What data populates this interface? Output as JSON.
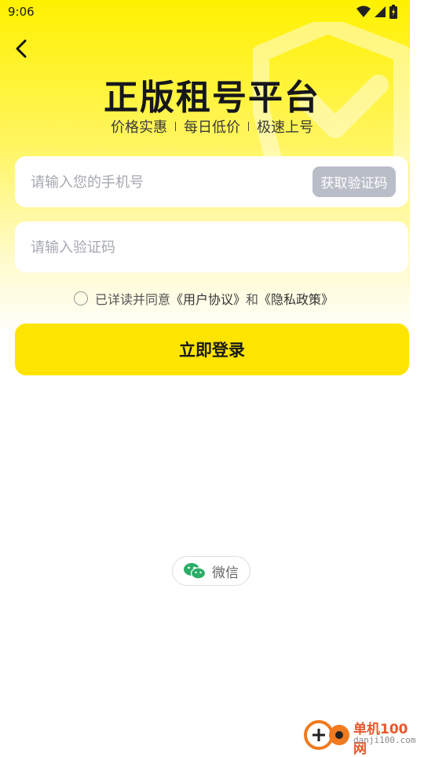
{
  "status_bar": {
    "time": "9:06"
  },
  "header": {
    "title": "正版租号平台",
    "subtitle_items": [
      "价格实惠",
      "每日低价",
      "极速上号"
    ]
  },
  "form": {
    "phone_placeholder": "请输入您的手机号",
    "get_code_label": "获取验证码",
    "code_placeholder": "请输入验证码"
  },
  "agreement": {
    "prefix": "已详读并同意",
    "user_agreement": "《用户协议》",
    "conjunction": "和",
    "privacy_policy": "《隐私政策》"
  },
  "login_label": "立即登录",
  "wechat_label": "微信",
  "watermark": {
    "name": "单机100网",
    "url": "danji100.com"
  },
  "colors": {
    "brand_yellow": "#ffe400",
    "disabled_button": "#b9bdc7",
    "wechat_green": "#2aae67"
  }
}
